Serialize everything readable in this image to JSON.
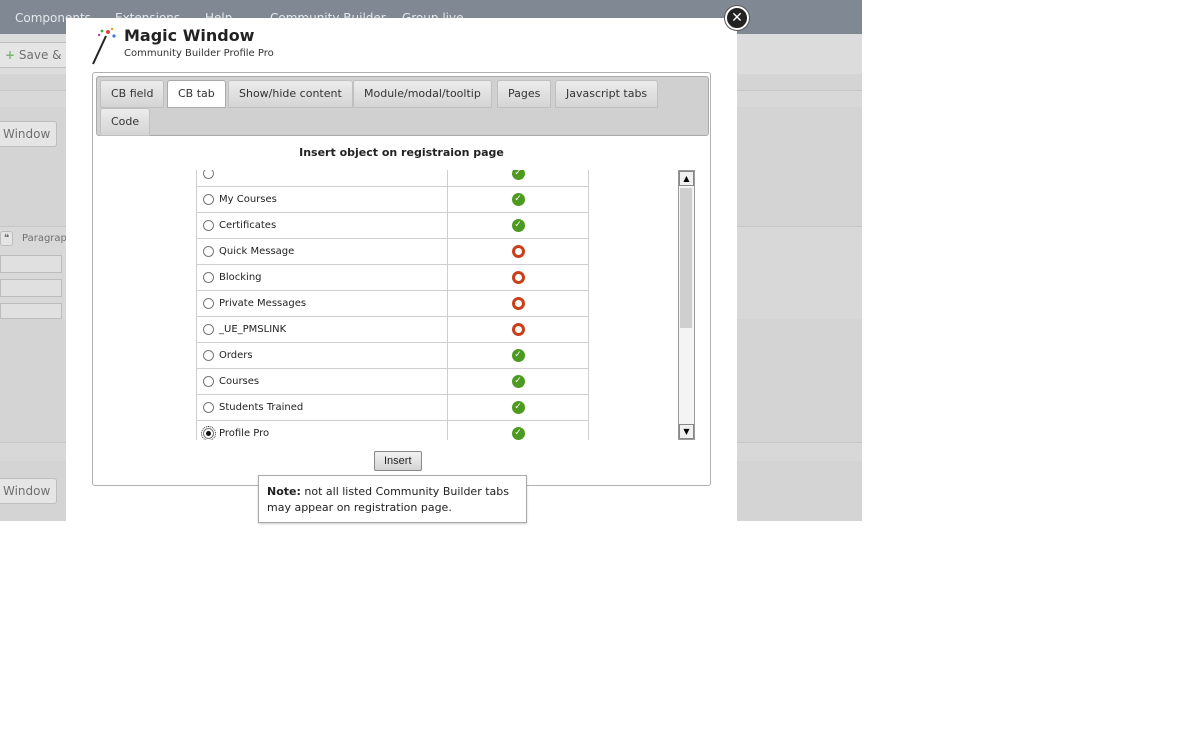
{
  "background": {
    "nav_items": [
      "Components",
      "Extensions",
      "Help",
      "Community Builder",
      "Group live"
    ],
    "save_new": "Save & New",
    "window_label_1": "Window",
    "window_label_2": "Window",
    "paragraph_label": "Paragrap"
  },
  "modal": {
    "title": "Magic Window",
    "subtitle": "Community Builder Profile Pro",
    "close_glyph": "✕",
    "tabs": [
      {
        "label": "CB field",
        "active": false
      },
      {
        "label": "CB tab",
        "active": true
      },
      {
        "label": "Show/hide content",
        "active": false
      },
      {
        "label": "Module/modal/tooltip",
        "active": false
      },
      {
        "label": "Pages",
        "active": false
      },
      {
        "label": "Javascript tabs",
        "active": false
      },
      {
        "label": "Code",
        "active": false
      }
    ],
    "section_heading": "Insert object on registraion page",
    "rows": [
      {
        "name": "",
        "status": "ok",
        "selected": false
      },
      {
        "name": "My Courses",
        "status": "ok",
        "selected": false
      },
      {
        "name": "Certificates",
        "status": "ok",
        "selected": false
      },
      {
        "name": "Quick Message",
        "status": "no",
        "selected": false
      },
      {
        "name": "Blocking",
        "status": "no",
        "selected": false
      },
      {
        "name": "Private Messages",
        "status": "no",
        "selected": false
      },
      {
        "name": "_UE_PMSLINK",
        "status": "no",
        "selected": false
      },
      {
        "name": "Orders",
        "status": "ok",
        "selected": false
      },
      {
        "name": "Courses",
        "status": "ok",
        "selected": false
      },
      {
        "name": "Students Trained",
        "status": "ok",
        "selected": false
      },
      {
        "name": "Profile Pro",
        "status": "ok",
        "selected": true
      }
    ],
    "insert_label": "Insert",
    "note_label": "Note:",
    "note_text": "not all listed Community Builder tabs may appear on registration page."
  },
  "colors": {
    "ok": "#4c9a1f",
    "no": "#c8401a",
    "nav_bg": "#3c4a5a"
  },
  "icons": {
    "ok": "checkmark-circle-icon",
    "no": "ring-icon",
    "wand": "magic-wand-icon"
  }
}
